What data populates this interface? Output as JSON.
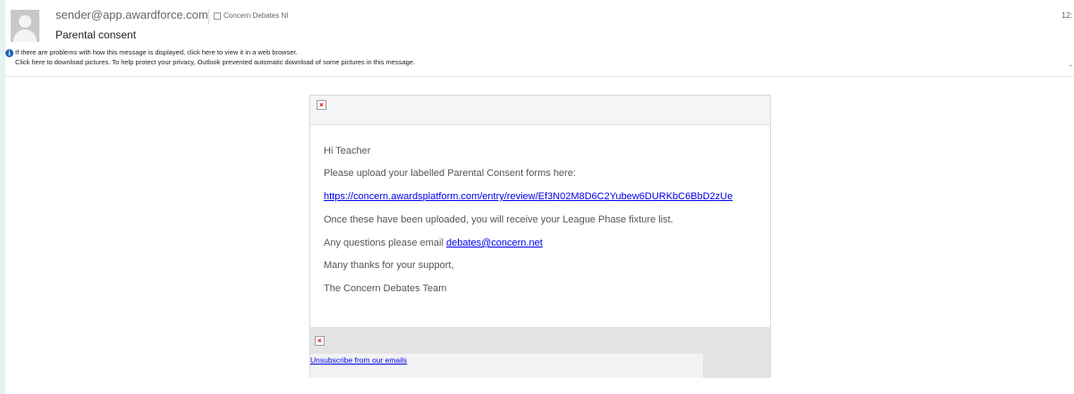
{
  "header": {
    "sender": "sender@app.awardforce.com",
    "category": "Concern Debates NI",
    "time": "12:",
    "subject": "Parental consent",
    "info_line1": "If there are problems with how this message is displayed, click here to view it in a web browser.",
    "info_line2": "Click here to download pictures. To help protect your privacy, Outlook prevented automatic download of some pictures in this message.",
    "right_mark": "ˇ"
  },
  "email": {
    "greeting": "Hi Teacher",
    "instruction": "Please upload your labelled Parental Consent forms here:",
    "upload_link": "https://concern.awardsplatform.com/entry/review/Ef3N02M8D6C2Yubew6DURKbC6BbD2zUe",
    "after_upload": "Once these have been uploaded, you will receive your League Phase fixture list.",
    "questions_prefix": "Any questions please email ",
    "questions_email": "debates@concern.net",
    "thanks": "Many thanks for your support,",
    "signoff": "The Concern Debates Team",
    "broken_image_glyph": "×",
    "unsubscribe": "Unsubscribe from our emails"
  },
  "colors": {
    "page_background": "#e4f3f3",
    "link": "#0000ee",
    "info_icon": "#1e64b4",
    "broken_image_x": "#cc0000"
  },
  "icons": {
    "avatar": "default-person-avatar",
    "info": "info-icon",
    "broken_image": "broken-image-icon"
  }
}
